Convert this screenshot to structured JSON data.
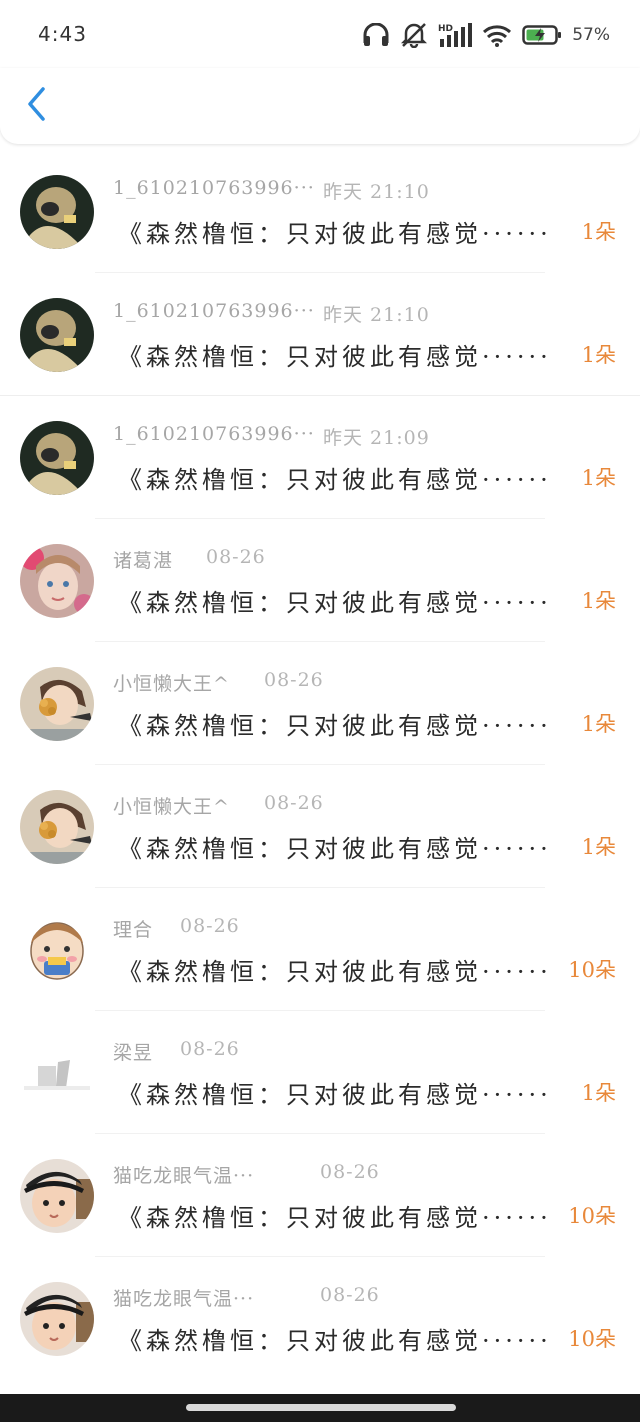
{
  "status_bar": {
    "time": "4:43",
    "battery_percent": "57%",
    "icons": [
      "headphones-icon",
      "mute-icon",
      "hd-signal-icon",
      "wifi-icon",
      "battery-charging-icon"
    ]
  },
  "header": {
    "back_icon": "chevron-left-icon",
    "accent_color": "#2f8ee0"
  },
  "colors": {
    "count": "#e8883a",
    "name": "#a6a6a6",
    "message": "#2b2b2b"
  },
  "items": [
    {
      "name": "1_610210763996···",
      "date": "昨天 21:10",
      "message": "《森然橹恒：只对彼此有感觉······",
      "count": "1朵",
      "avatar": "avatar-dark-photo"
    },
    {
      "name": "1_610210763996···",
      "date": "昨天 21:10",
      "message": "《森然橹恒：只对彼此有感觉······",
      "count": "1朵",
      "avatar": "avatar-dark-photo"
    },
    {
      "name": "1_610210763996···",
      "date": "昨天 21:09",
      "message": "《森然橹恒：只对彼此有感觉······",
      "count": "1朵",
      "avatar": "avatar-dark-photo"
    },
    {
      "name": "诸葛湛",
      "date": "08-26",
      "message": "《森然橹恒：只对彼此有感觉······",
      "count": "1朵",
      "avatar": "avatar-girl-photo"
    },
    {
      "name": "小恒懒大王^",
      "date": "08-26",
      "message": "《森然橹恒：只对彼此有感觉······",
      "count": "1朵",
      "avatar": "avatar-boy-flower-photo"
    },
    {
      "name": "小恒懒大王^",
      "date": "08-26",
      "message": "《森然橹恒：只对彼此有感觉······",
      "count": "1朵",
      "avatar": "avatar-boy-flower-photo"
    },
    {
      "name": "理合",
      "date": "08-26",
      "message": "《森然橹恒：只对彼此有感觉······",
      "count": "10朵",
      "avatar": "avatar-cartoon"
    },
    {
      "name": "梁昱",
      "date": "08-26",
      "message": "《森然橹恒：只对彼此有感觉······",
      "count": "1朵",
      "avatar": "avatar-light-photo"
    },
    {
      "name": "猫吃龙眼气温···",
      "date": "08-26",
      "message": "《森然橹恒：只对彼此有感觉······",
      "count": "10朵",
      "avatar": "avatar-boy-cap-photo"
    },
    {
      "name": "猫吃龙眼气温···",
      "date": "08-26",
      "message": "《森然橹恒：只对彼此有感觉······",
      "count": "10朵",
      "avatar": "avatar-boy-cap-photo"
    }
  ]
}
